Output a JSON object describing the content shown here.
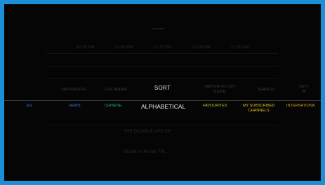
{
  "menu": {
    "title": "SORT",
    "options": [
      {
        "label": "ES",
        "color": "#2e7ad1"
      },
      {
        "label": "NEWS",
        "color": "#2e7ad1"
      },
      {
        "label": "CHINESE",
        "color": "#1fa7a0"
      },
      {
        "label": "ALPHABETICAL",
        "color": "#e6e6e6"
      },
      {
        "label": "FAVOURITES",
        "color": "#b8c820"
      },
      {
        "label": "MY SUBSCRIBED\nCHANNELS",
        "color": "#e3c21a"
      },
      {
        "label": "INTERNATIONA",
        "color": "#d89a1a"
      }
    ],
    "selected": "ALPHABETICAL",
    "top_items": [
      {
        "label": "FAVOURITES",
        "sub": ""
      },
      {
        "label": "LIVE ARENA",
        "sub": ""
      },
      {
        "label": "SWITCH TO LIST\nGUIDE",
        "sub": ""
      },
      {
        "label": "SEARCH",
        "sub": ""
      },
      {
        "label": "SETT\nM",
        "sub": ""
      }
    ]
  },
  "background": {
    "guide_times": [
      "10:30 PM",
      "11:00 PM",
      "11:30 PM",
      "12:00 AM",
      "12:30 AM"
    ],
    "program_title": "THE DOUBLE LIFE OF",
    "description": "Murder in the late '70s..."
  }
}
